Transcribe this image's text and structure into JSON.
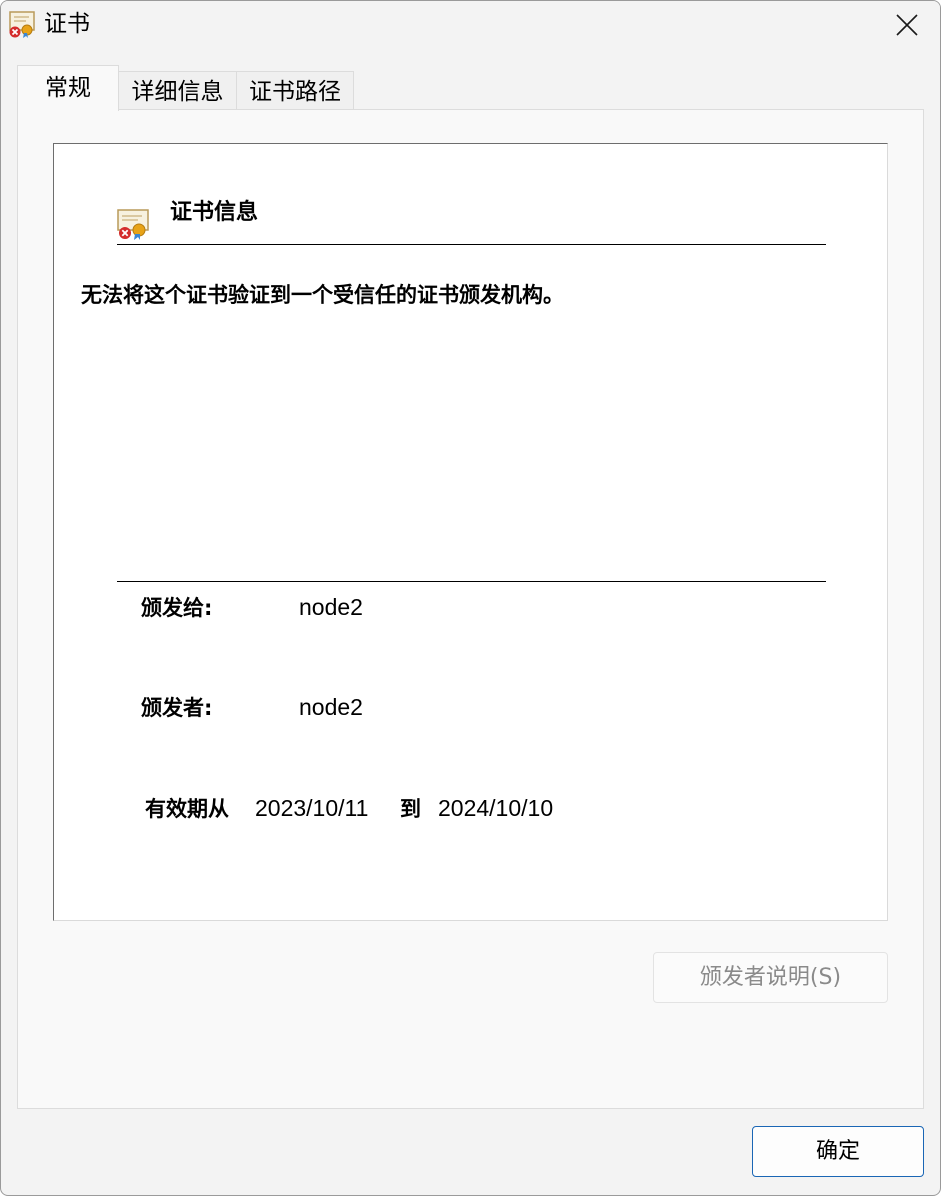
{
  "window": {
    "title": "证书",
    "icon": "certificate-error-icon"
  },
  "tabs": [
    {
      "label": "常规",
      "active": true
    },
    {
      "label": "详细信息",
      "active": false
    },
    {
      "label": "证书路径",
      "active": false
    }
  ],
  "general": {
    "section_title": "证书信息",
    "warning": "无法将这个证书验证到一个受信任的证书颁发机构。",
    "issued_to_label": "颁发给:",
    "issued_to_value": "node2",
    "issued_by_label": "颁发者:",
    "issued_by_value": "node2",
    "valid_from_label": "有效期从",
    "valid_from_value": "2023/10/11",
    "valid_to_label": "到",
    "valid_to_value": "2024/10/10"
  },
  "buttons": {
    "issuer_statement": "颁发者说明(S)",
    "issuer_statement_enabled": false,
    "ok": "确定"
  },
  "colors": {
    "accent": "#1a66b5",
    "error": "#d42c2c",
    "seal": "#e8a317"
  }
}
